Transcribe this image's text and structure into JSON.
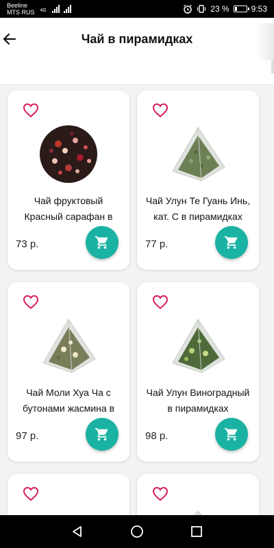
{
  "status": {
    "carrier_line1": "Beeline",
    "carrier_line2": "MTS RUS",
    "network": "4G",
    "battery_percent": "23 %",
    "battery_level": 0.23,
    "time": "9:53"
  },
  "header": {
    "title": "Чай в пирамидках",
    "back_icon": "arrow-left-icon"
  },
  "colors": {
    "accent": "#1ab3a3",
    "favorite": "#d81b60",
    "background": "#f3f3f3"
  },
  "products": [
    {
      "name": "Чай фруктовый Красный сарафан в пирамидках",
      "price": "73 р.",
      "image": "fruit-tea-image"
    },
    {
      "name": "Чай Улун Те Гуань Инь, кат. С в пирамидках",
      "price": "77 р.",
      "image": "pyramid-teabag-image"
    },
    {
      "name": "Чай Моли Хуа Ча с бутонами жасмина в пирамидках",
      "price": "97 р.",
      "image": "pyramid-teabag-image"
    },
    {
      "name": "Чай Улун Виноградный в пирамидках",
      "price": "98 р.",
      "image": "pyramid-teabag-image"
    }
  ],
  "icons": {
    "favorite": "heart-outline-icon",
    "cart": "cart-icon"
  }
}
